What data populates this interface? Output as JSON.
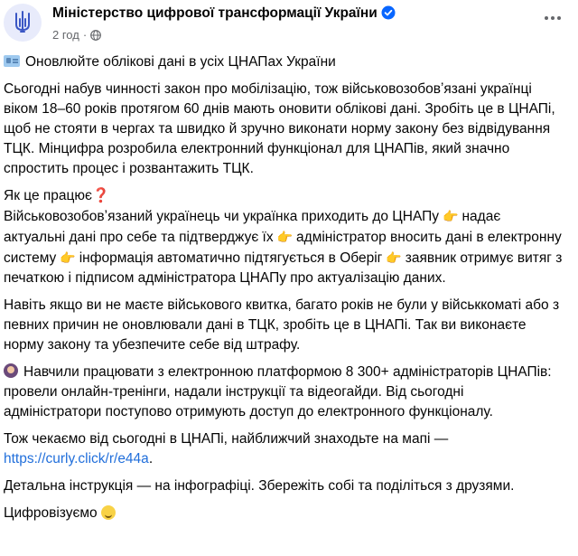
{
  "post": {
    "page_name": "Міністерство цифрової трансформації України",
    "time": "2 год",
    "dot": "·"
  },
  "content": {
    "heading": "Оновлюйте облікові дані в усіх ЦНАПах України",
    "para1": "Сьогодні набув чинності закон про мобілізацію, тож військовозобовʼязані українці віком 18–60 років протягом 60 днів мають оновити облікові дані. Зробіть це в ЦНАПі, щоб не стояти в чергах та швидко й зручно виконати норму закону без відвідування ТЦК. Мінцифра розробила електронний функціонал для ЦНАПів, який значно спростить процес і розвантажить ТЦК.",
    "how_title": "Як це працює",
    "how_q": "❓",
    "how_step1": "Військовозобовʼязаний українець чи українка приходить до ЦНАПу",
    "how_step2": "надає актуальні дані про себе та підтверджує їх",
    "how_step3": "адміністратор вносить дані в електронну систему",
    "how_step4": "інформація автоматично підтягується в Оберіг",
    "how_step5": "заявник отримує витяг з печаткою і підписом адміністратора ЦНАПу про актуалізацію даних.",
    "pointer": "👉",
    "para3": "Навіть якщо ви не маєте військового квитка, багато років не були у військкоматі або з певних причин не оновлювали дані в ТЦК, зробіть це в ЦНАПі. Так ви виконаєте норму закону та убезпечите себе від штрафу.",
    "para4": "Навчили працювати з електронною платформою 8 300+ адміністраторів ЦНАПів: провели онлайн-тренінги, надали інструкції та відеогайди. Від сьогодні адміністратори поступово отримують доступ до електронного функціоналу.",
    "para5_text": "Тож чекаємо від сьогодні в ЦНАПі, найближчий знаходьте на мапі —",
    "para5_link": "https://curly.click/r/e44a",
    "para5_end": ".",
    "para6": "Детальна інструкція — на інфографіці. Збережіть собі та поділіться з друзями.",
    "para7": "Цифровізуємо"
  },
  "icons": {
    "avatar": "trident-logo-icon",
    "verified": "verified-badge-icon",
    "privacy": "globe-icon",
    "more": "more-options-icon"
  },
  "colors": {
    "link": "#216fdb",
    "verified": "#0866ff",
    "meta": "#65676b"
  }
}
